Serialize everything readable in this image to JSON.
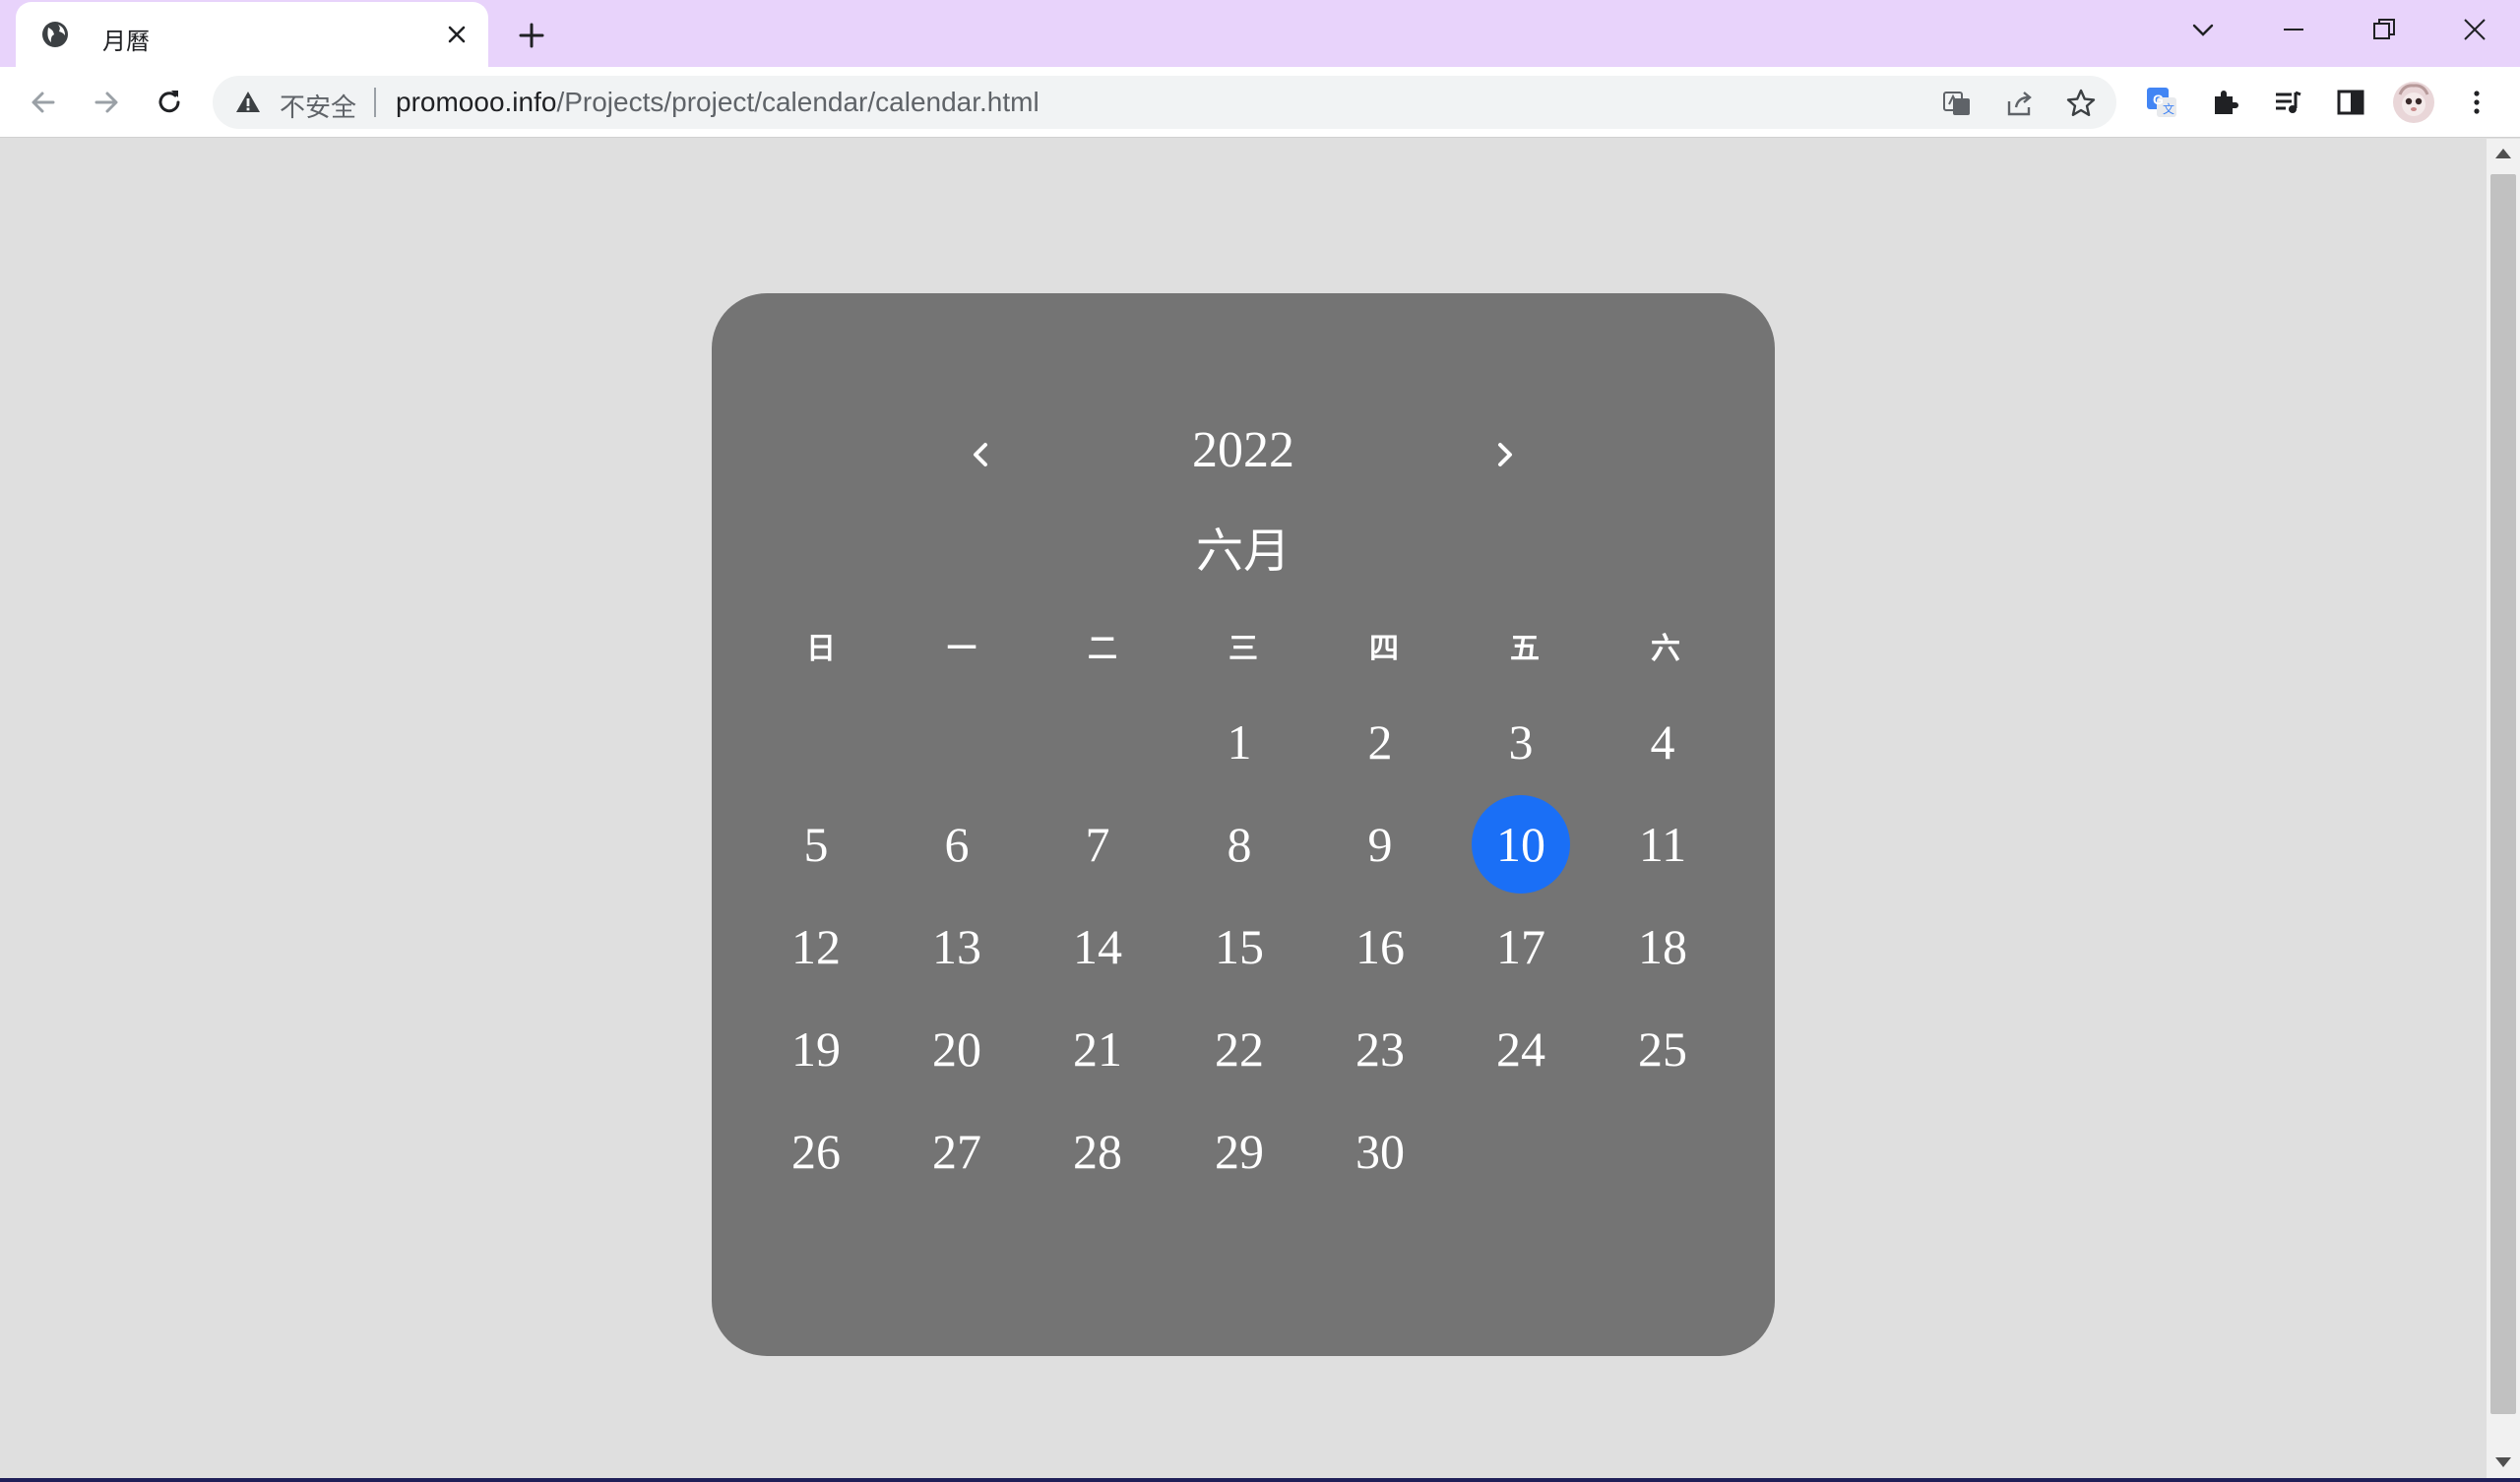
{
  "browser": {
    "tab_title": "月曆",
    "insecure_label": "不安全",
    "url_host": "promooo.info",
    "url_path": "/Projects/project/calendar/calendar.html"
  },
  "calendar": {
    "year": "2022",
    "month": "六月",
    "prev_icon": "chevron-left-icon",
    "next_icon": "chevron-right-icon",
    "weekdays": [
      "日",
      "一",
      "二",
      "三",
      "四",
      "五",
      "六"
    ],
    "first_weekday_index": 3,
    "days_in_month": 30,
    "selected_day": 10,
    "accent_color": "#1a6ff6",
    "card_color": "#747474",
    "page_bg": "#dfdfdf"
  }
}
